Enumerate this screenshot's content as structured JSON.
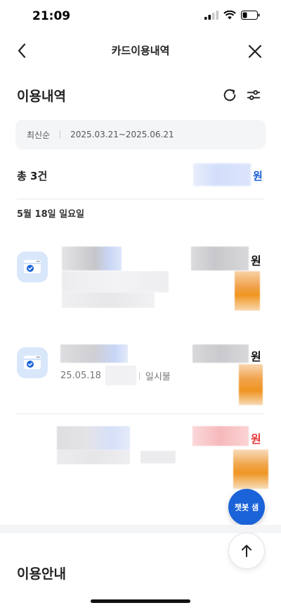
{
  "status_bar": {
    "time": "21:09"
  },
  "nav": {
    "title": "카드이용내역"
  },
  "section": {
    "title": "이용내역"
  },
  "filter": {
    "sort": "최신순",
    "date_range": "2025.03.21~2025.06.21"
  },
  "summary": {
    "total_label": "총 3건",
    "currency_unit": "원"
  },
  "date_group": {
    "label": "5월 18일 일요일"
  },
  "transactions": [
    {
      "currency_unit": "원"
    },
    {
      "currency_unit": "원",
      "date": "25.05.18",
      "payment_type": "일시불"
    },
    {
      "currency_unit": "원"
    }
  ],
  "chatbot": {
    "label": "챗봇 샘"
  },
  "guide": {
    "title": "이용안내"
  },
  "colors": {
    "accent": "#1b63d8",
    "cancel": "#e5393b",
    "amount_blue": "#1a5fd1"
  }
}
